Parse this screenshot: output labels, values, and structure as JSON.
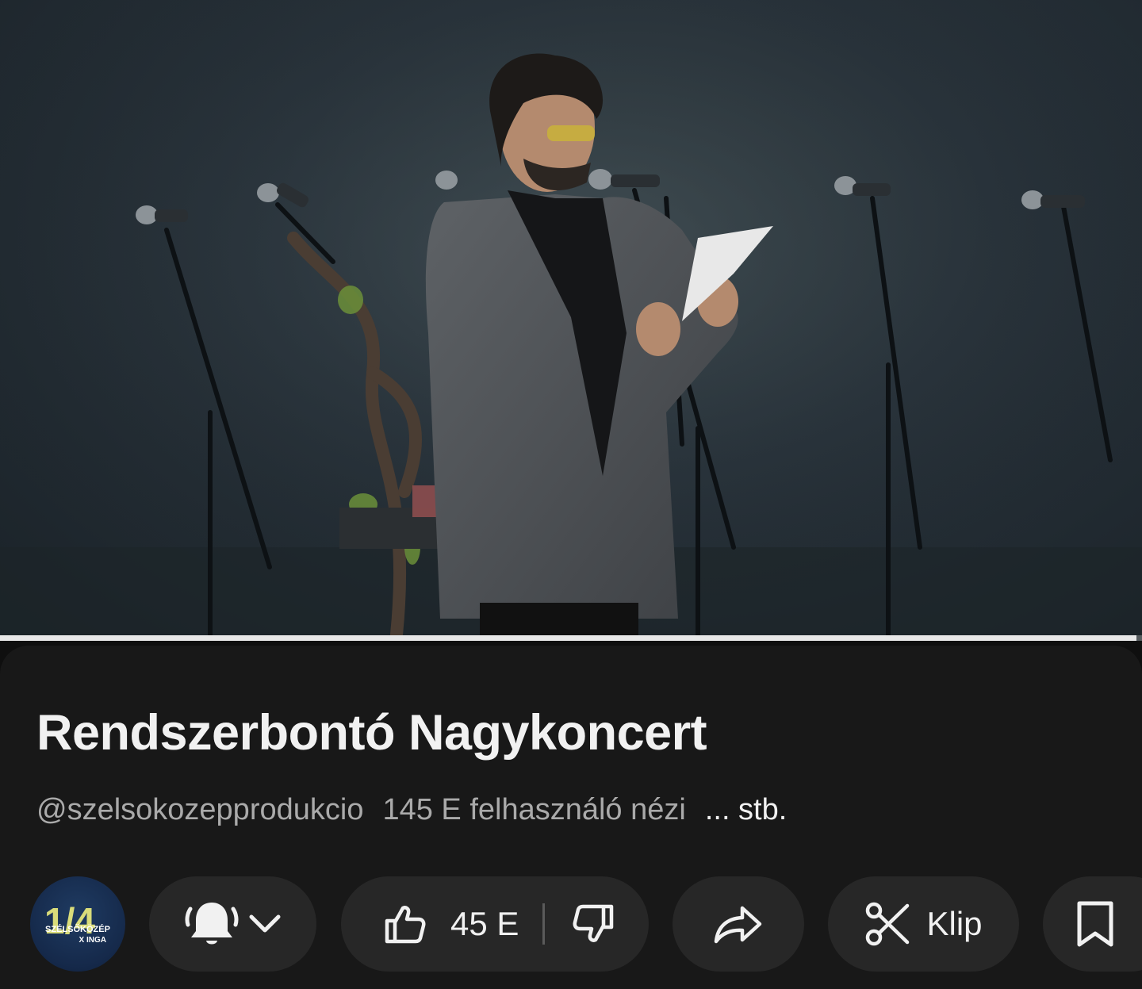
{
  "video": {
    "progress_fraction": 0.995
  },
  "info": {
    "title": "Rendszerbontó Nagykoncert",
    "channel_handle": "@szelsokozepprodukcio",
    "views": "145 E felhasználó nézi",
    "more_label": "... stb."
  },
  "channel_avatar": {
    "logo_text": "1/4",
    "caption_line1": "SZÉLSŐKÖZÉP",
    "caption_line2": "X INGA"
  },
  "actions": {
    "notifications_icon": "bell-icon",
    "likes_count": "45 E",
    "clip_label": "Klip",
    "share_icon": "share-arrow-icon",
    "save_icon": "bookmark-icon"
  }
}
